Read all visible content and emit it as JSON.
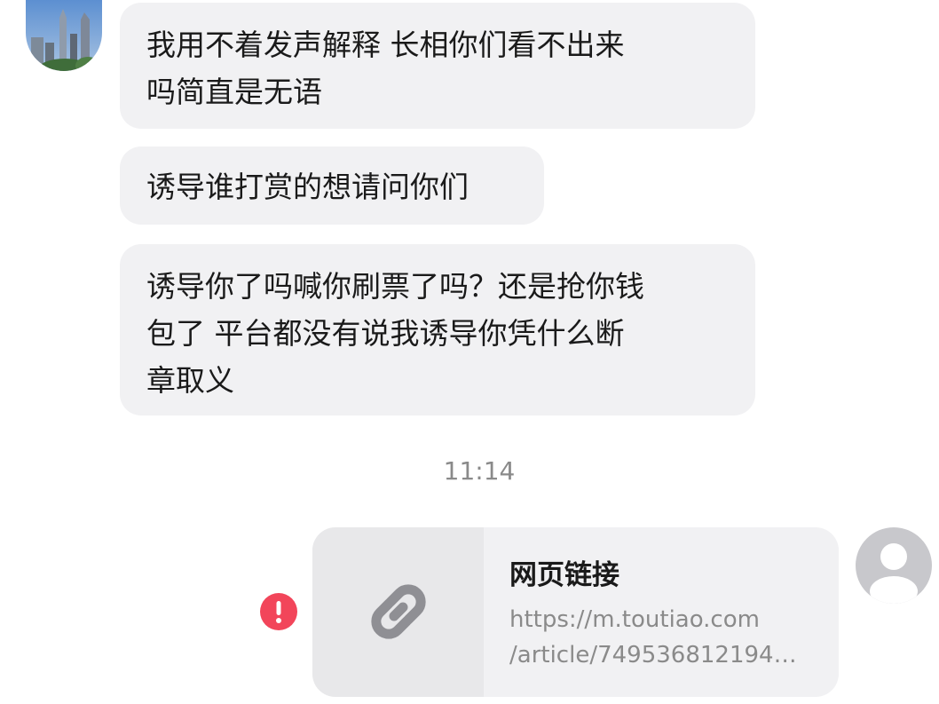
{
  "messages": [
    {
      "sender": "other",
      "text": "我用不着发声解释 长相你们看不出来\n吗简直是无语"
    },
    {
      "sender": "other",
      "text": "诱导谁打赏的想请问你们"
    },
    {
      "sender": "other",
      "text": "诱导你了吗喊你刷票了吗？还是抢你钱\n包了 平台都没有说我诱导你凭什么断\n章取义"
    }
  ],
  "timestamp": "11:14",
  "link_message": {
    "title": "网页链接",
    "url": "https://m.toutiao.com\n/article/749536812194…",
    "thumbnail_icon": "link-icon",
    "status_icon": "error-icon",
    "status_color": "#f2455a"
  },
  "avatars": {
    "other": "city-skyline-avatar",
    "self": "default-user-avatar"
  }
}
